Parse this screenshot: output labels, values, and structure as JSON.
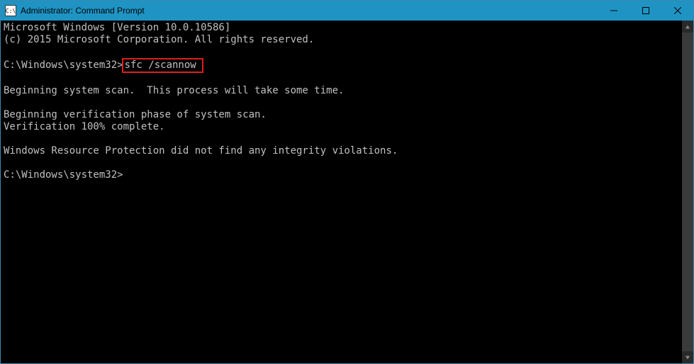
{
  "titlebar": {
    "icon_text": "C:\\",
    "title": "Administrator: Command Prompt"
  },
  "console": {
    "line1": "Microsoft Windows [Version 10.0.10586]",
    "line2": "(c) 2015 Microsoft Corporation. All rights reserved.",
    "prompt1": "C:\\Windows\\system32>",
    "command1": "sfc /scannow",
    "line3": "Beginning system scan.  This process will take some time.",
    "line4": "Beginning verification phase of system scan.",
    "line5": "Verification 100% complete.",
    "line6": "Windows Resource Protection did not find any integrity violations.",
    "prompt2": "C:\\Windows\\system32>"
  }
}
